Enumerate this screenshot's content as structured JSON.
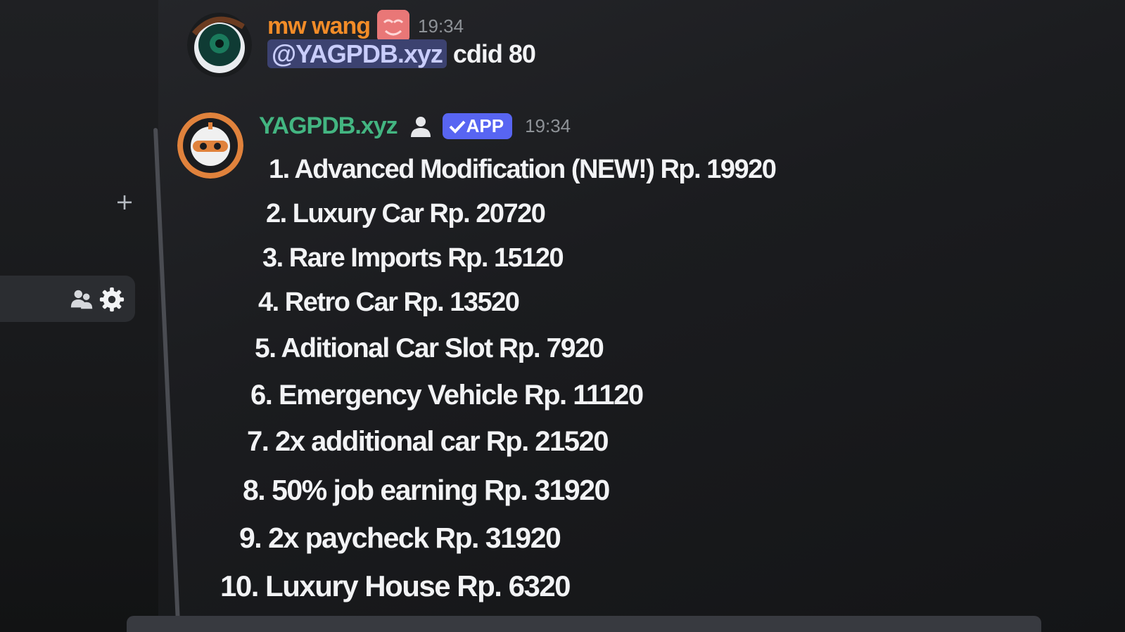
{
  "sidebar": {
    "add_label": "+",
    "panel_icons": [
      "members-icon",
      "gear-icon"
    ]
  },
  "messages": [
    {
      "username": "mw wang",
      "username_color": "#f28c28",
      "timestamp": "19:34",
      "mention": "@YAGPDB.xyz",
      "text": "cdid 80"
    },
    {
      "username": "YAGPDB.xyz",
      "username_color": "#43b581",
      "badge": "APP",
      "timestamp": "19:34",
      "lines": [
        "1. Advanced Modification (NEW!) Rp. 19920",
        "2. Luxury Car Rp. 20720",
        "3. Rare Imports Rp. 15120",
        "4. Retro Car Rp. 13520",
        "5. Aditional Car Slot Rp. 7920",
        "6. Emergency Vehicle Rp. 11120",
        "7. 2x additional car Rp. 21520",
        "8. 50% job earning Rp. 31920",
        "9. 2x paycheck Rp. 31920",
        "10. Luxury House Rp. 6320"
      ]
    }
  ]
}
